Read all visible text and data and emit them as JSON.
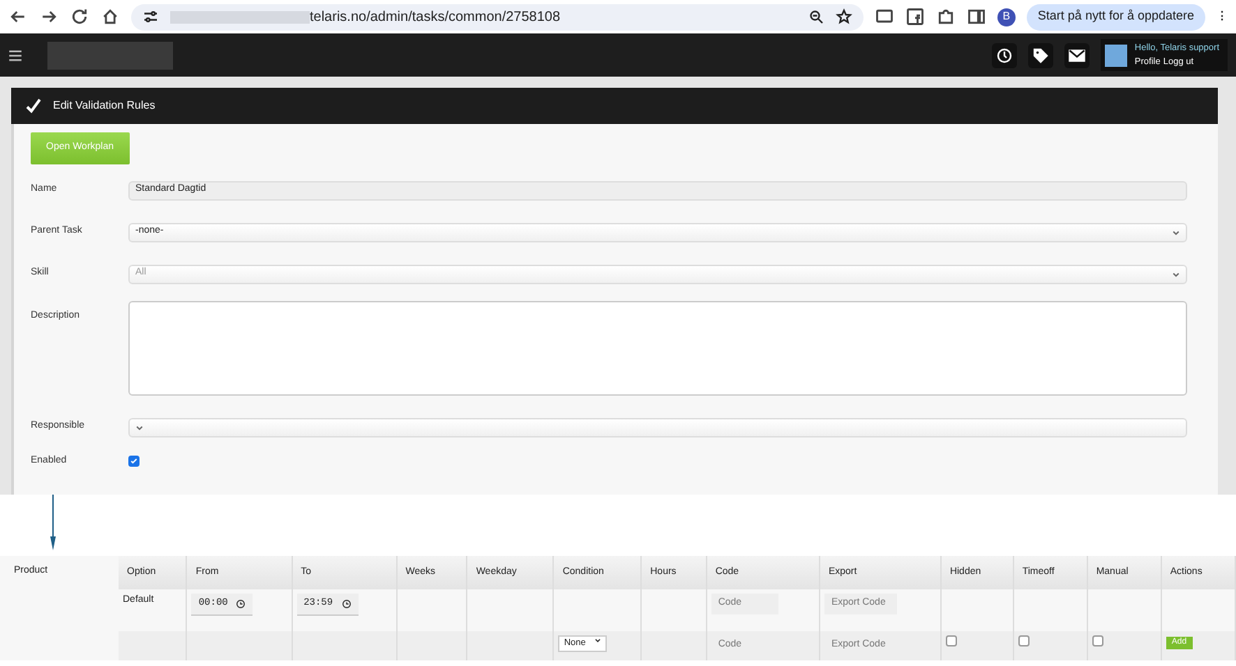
{
  "browser": {
    "url": "telaris.no/admin/tasks/common/2758108",
    "profile_initial": "B",
    "update_button": "Start på nytt for å oppdatere",
    "menu": "⋮"
  },
  "app_bar": {
    "greeting": "Hello, Telaris support",
    "links": [
      "Profile",
      "Logg ut"
    ]
  },
  "panel": {
    "title": "Edit Validation Rules",
    "open_button": "Open Workplan",
    "fields": [
      {
        "label": "Name",
        "kind": "text",
        "value": "Standard Dagtid"
      },
      {
        "label": "Parent Task",
        "kind": "select",
        "value": "-none-"
      },
      {
        "label": "Skill",
        "kind": "select",
        "placeholder": "All"
      },
      {
        "label": "Description",
        "kind": "textarea"
      },
      {
        "label": "Responsible",
        "kind": "select"
      },
      {
        "label": "Enabled",
        "kind": "checkbox",
        "checked": true
      }
    ]
  },
  "product": {
    "label": "Product",
    "columns": [
      "Option",
      "From",
      "To",
      "Weeks",
      "Weekday",
      "Condition",
      "Hours",
      "Code",
      "Export",
      "Hidden",
      "Timeoff",
      "Manual",
      "Actions"
    ],
    "rows": [
      {
        "kind": "default",
        "option": "Default",
        "from": "00:00",
        "to": "23:59",
        "code_placeholder": "Code",
        "export_placeholder": "Export Code"
      },
      {
        "kind": "new",
        "condition": "None",
        "code_placeholder": "Code",
        "export_placeholder": "Export Code",
        "hidden": false,
        "timeoff": false,
        "manual": false,
        "action": "Add"
      }
    ]
  }
}
